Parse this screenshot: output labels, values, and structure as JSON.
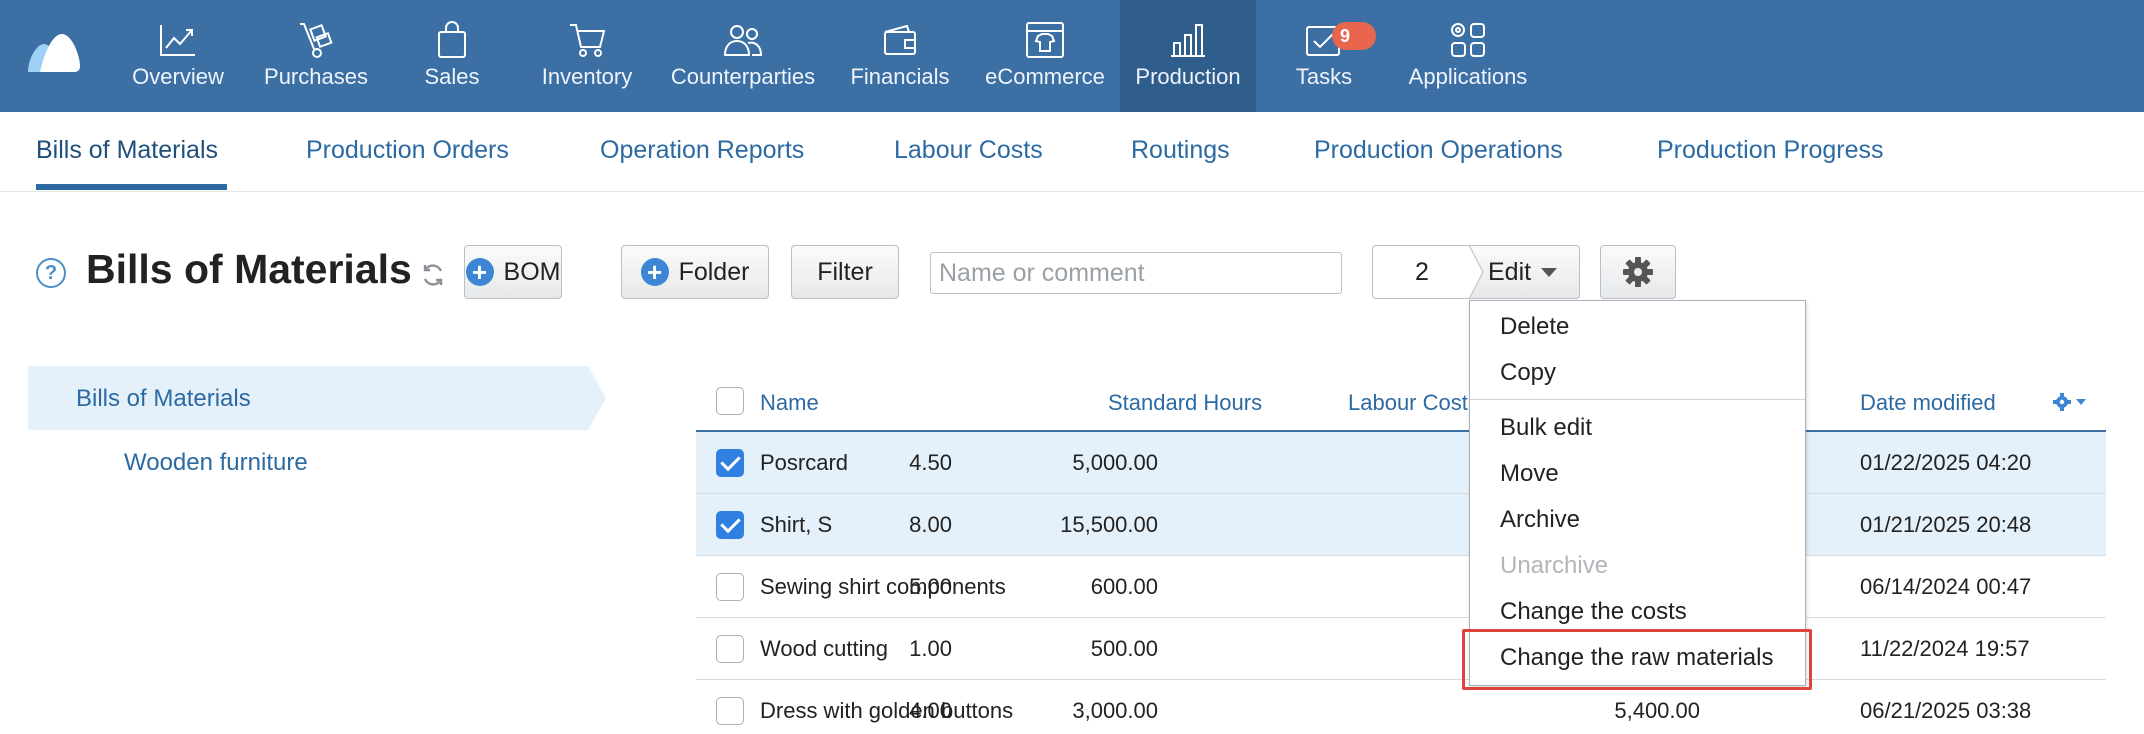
{
  "colors": {
    "nav_bg": "#3c6fa4",
    "nav_active": "#2f5d8c",
    "accent": "#2c6aa3",
    "badge": "#e8664e",
    "highlight": "#e0433a",
    "selected_row": "#e4f0fa"
  },
  "topnav": {
    "items": [
      {
        "label": "Overview",
        "icon": "chart-line-icon"
      },
      {
        "label": "Purchases",
        "icon": "hand-truck-icon"
      },
      {
        "label": "Sales",
        "icon": "shopping-bag-icon"
      },
      {
        "label": "Inventory",
        "icon": "cart-icon"
      },
      {
        "label": "Counterparties",
        "icon": "people-icon"
      },
      {
        "label": "Financials",
        "icon": "wallet-icon"
      },
      {
        "label": "eCommerce",
        "icon": "storefront-shirt-icon"
      },
      {
        "label": "Production",
        "icon": "factory-icon",
        "active": true
      },
      {
        "label": "Tasks",
        "icon": "task-check-icon",
        "badge": "9"
      },
      {
        "label": "Applications",
        "icon": "apps-grid-icon"
      }
    ]
  },
  "subnav": {
    "tabs": [
      {
        "label": "Bills of Materials",
        "active": true
      },
      {
        "label": "Production Orders"
      },
      {
        "label": "Operation Reports"
      },
      {
        "label": "Labour Costs"
      },
      {
        "label": "Routings"
      },
      {
        "label": "Production Operations"
      },
      {
        "label": "Production Progress"
      }
    ]
  },
  "toolbar": {
    "help": "?",
    "title": "Bills of Materials",
    "bom_label": "BOM",
    "folder_label": "Folder",
    "filter_label": "Filter",
    "search_placeholder": "Name or comment",
    "selected_count": "2",
    "edit_label": "Edit"
  },
  "folders": {
    "root": "Bills of Materials",
    "children": [
      "Wooden furniture"
    ]
  },
  "table": {
    "columns": {
      "name": "Name",
      "hours": "Standard Hours",
      "labour": "Labour Cost",
      "date": "Date modified"
    },
    "rows": [
      {
        "checked": true,
        "name": "Posrcard",
        "hours": "4.50",
        "labour": "5,000.00",
        "extra": "",
        "date": "01/22/2025 04:20"
      },
      {
        "checked": true,
        "name": "Shirt, S",
        "hours": "8.00",
        "labour": "15,500.00",
        "extra": "",
        "date": "01/21/2025 20:48"
      },
      {
        "checked": false,
        "name": "Sewing shirt components",
        "hours": "5.00",
        "labour": "600.00",
        "extra": "",
        "date": "06/14/2024 00:47"
      },
      {
        "checked": false,
        "name": "Wood cutting",
        "hours": "1.00",
        "labour": "500.00",
        "extra": "",
        "date": "11/22/2024 19:57"
      },
      {
        "checked": false,
        "name": "Dress with golden buttons",
        "hours": "4.00",
        "labour": "3,000.00",
        "extra": "5,400.00",
        "date": "06/21/2025 03:38"
      }
    ]
  },
  "edit_menu": {
    "items": [
      {
        "label": "Delete"
      },
      {
        "label": "Copy"
      },
      {
        "label": "Bulk edit"
      },
      {
        "label": "Move"
      },
      {
        "label": "Archive"
      },
      {
        "label": "Unarchive",
        "disabled": true
      },
      {
        "label": "Change the costs"
      },
      {
        "label": "Change the raw materials",
        "highlighted": true
      }
    ]
  }
}
